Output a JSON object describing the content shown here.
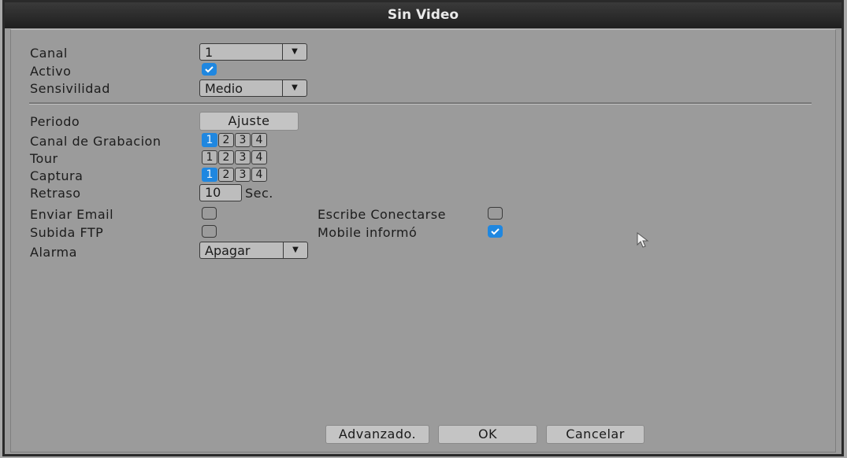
{
  "title": "Sin Video",
  "colors": {
    "accent": "#1f87e0",
    "titlebar": "#262626",
    "panel": "#9b9b9b"
  },
  "form": {
    "canal": {
      "label": "Canal",
      "value": "1"
    },
    "activo": {
      "label": "Activo",
      "checked": true
    },
    "sensivilidad": {
      "label": "Sensivilidad",
      "value": "Medio"
    },
    "periodo": {
      "label": "Periodo",
      "button": "Ajuste"
    },
    "canal_grabacion": {
      "label": "Canal de Grabacion",
      "channels": [
        "1",
        "2",
        "3",
        "4"
      ],
      "selected": [
        "1"
      ]
    },
    "tour": {
      "label": "Tour",
      "channels": [
        "1",
        "2",
        "3",
        "4"
      ],
      "selected": []
    },
    "captura": {
      "label": "Captura",
      "channels": [
        "1",
        "2",
        "3",
        "4"
      ],
      "selected": [
        "1"
      ]
    },
    "retraso": {
      "label": "Retraso",
      "value": "10",
      "unit": "Sec."
    },
    "enviar_email": {
      "label": "Enviar Email",
      "checked": false
    },
    "subida_ftp": {
      "label": "Subida FTP",
      "checked": false
    },
    "alarma": {
      "label": "Alarma",
      "value": "Apagar"
    },
    "escribe_conectarse": {
      "label": "Escribe Conectarse",
      "checked": false
    },
    "mobile_informo": {
      "label": "Mobile informó",
      "checked": true
    }
  },
  "footer": {
    "advanced": "Advanzado.",
    "ok": "OK",
    "cancel": "Cancelar"
  },
  "icons": {
    "dropdown": "chevron-down-icon",
    "check": "checkmark-icon",
    "cursor": "mouse-pointer-icon"
  }
}
